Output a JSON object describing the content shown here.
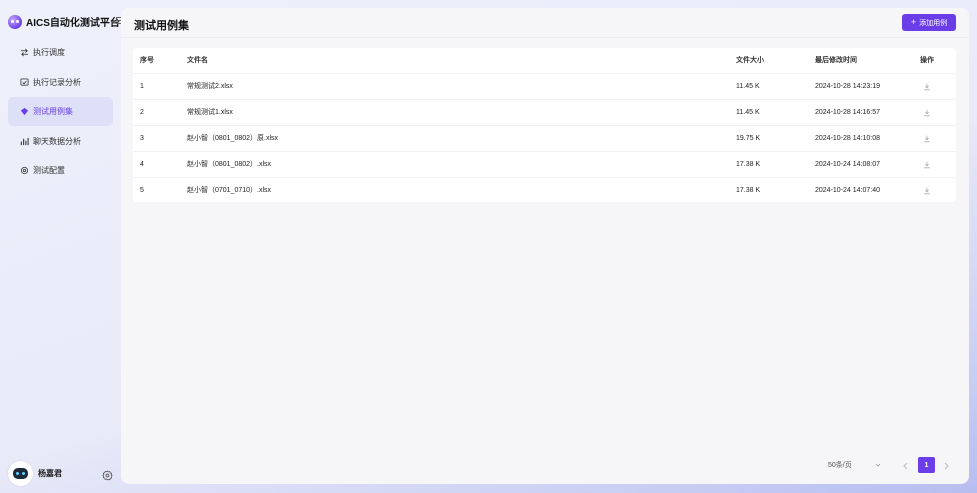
{
  "app": {
    "title": "AICS自动化测试平台"
  },
  "sidebar": {
    "items": [
      {
        "label": "执行调度",
        "icon": "schedule-icon",
        "active": false
      },
      {
        "label": "执行记录分析",
        "icon": "record-icon",
        "active": false
      },
      {
        "label": "测试用例集",
        "icon": "cases-icon",
        "active": true
      },
      {
        "label": "聊天数据分析",
        "icon": "chart-icon",
        "active": false
      },
      {
        "label": "测试配置",
        "icon": "gear-icon",
        "active": false
      }
    ],
    "user": {
      "name": "杨嘉君"
    }
  },
  "page": {
    "title": "测试用例集",
    "add_button_label": "添加用例"
  },
  "table": {
    "columns": [
      "序号",
      "文件名",
      "文件大小",
      "最后修改时间",
      "操作"
    ],
    "rows": [
      {
        "index": "1",
        "name": "常规测试2.xlsx",
        "size": "11.45 K",
        "modified": "2024-10-28 14:23:19"
      },
      {
        "index": "2",
        "name": "常规测试1.xlsx",
        "size": "11.45 K",
        "modified": "2024-10-28 14:16:57"
      },
      {
        "index": "3",
        "name": "赵小智（0801_0802）原.xlsx",
        "size": "19.75 K",
        "modified": "2024-10-28 14:10:08"
      },
      {
        "index": "4",
        "name": "赵小智（0801_0802）.xlsx",
        "size": "17.38 K",
        "modified": "2024-10-24 14:08:07"
      },
      {
        "index": "5",
        "name": "赵小智（0701_0710）.xlsx",
        "size": "17.38 K",
        "modified": "2024-10-24 14:07:40"
      }
    ]
  },
  "pagination": {
    "page_size_label": "50条/页",
    "current_page": "1"
  },
  "colors": {
    "accent": "#6a3de8",
    "active_menu_bg": "#dde0f7"
  }
}
